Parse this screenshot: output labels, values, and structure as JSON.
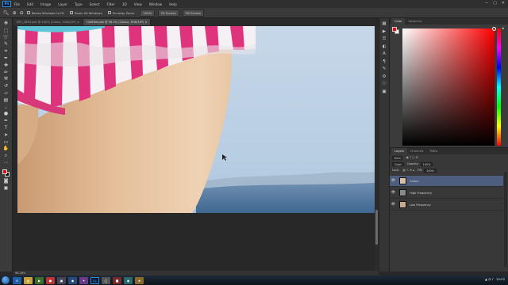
{
  "app": {
    "logo": "Ps"
  },
  "menu": [
    "File",
    "Edit",
    "Image",
    "Layer",
    "Type",
    "Select",
    "Filter",
    "3D",
    "View",
    "Window",
    "Help"
  ],
  "window_controls": {
    "minimize": "−",
    "maximize": "▢",
    "close": "✕"
  },
  "options": {
    "checks": [
      "Resize Windows to Fit",
      "Zoom All Windows",
      "Scrubby Zoom"
    ],
    "buttons": [
      "100%",
      "Fit Screen",
      "Fill Screen"
    ]
  },
  "tabs": [
    {
      "label": "IMG_4863.psd @ 100% (Colour, RGB/16*) ×",
      "active": false
    },
    {
      "label": "Untitled.psb @ 98.2% (Colour, RGB/16*) ×",
      "active": true
    }
  ],
  "status": {
    "zoom": "98.28%",
    "doc": "Doc: —"
  },
  "color_panel": {
    "tabs": [
      "Color",
      "Swatches"
    ],
    "active": "Color"
  },
  "layers_panel": {
    "tabs": [
      "Layers",
      "Channels",
      "Paths"
    ],
    "active": "Layers",
    "kind_label": "Kind",
    "blend_mode": "Color",
    "opacity_label": "Opacity:",
    "opacity_value": "100%",
    "lock_label": "Lock:",
    "fill_label": "Fill:",
    "fill_value": "100%",
    "layers": [
      {
        "name": "Colour",
        "visible": true,
        "selected": true
      },
      {
        "name": "High Frequency",
        "visible": true,
        "selected": false
      },
      {
        "name": "Low Frequency",
        "visible": true,
        "selected": false
      }
    ]
  },
  "taskbar": {
    "clock": "10:55",
    "date": "10/11/2013"
  },
  "colors": {
    "foreground": "#e01010",
    "background": "#111111",
    "selection": "#4c5d7d"
  }
}
